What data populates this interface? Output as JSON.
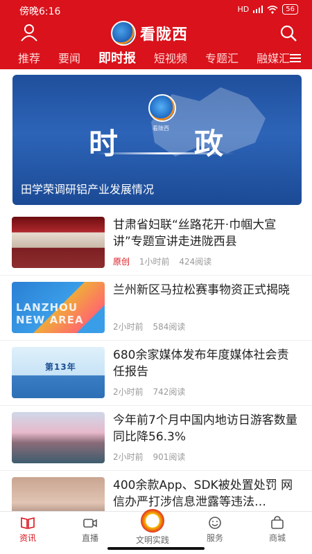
{
  "status_bar": {
    "time": "傍晚6:16",
    "signal": "HD",
    "battery": "56"
  },
  "app": {
    "name": "看陇西"
  },
  "tabs": [
    {
      "label": "推荐"
    },
    {
      "label": "要闻"
    },
    {
      "label": "即时报",
      "active": true
    },
    {
      "label": "短视频"
    },
    {
      "label": "专题汇"
    },
    {
      "label": "融媒汇"
    }
  ],
  "hero": {
    "big_left": "时",
    "big_right": "政",
    "emblem_text": "看陇西",
    "caption": "田学荣调研铝产业发展情况"
  },
  "news": [
    {
      "title": "甘肃省妇联“丝路花开·巾帼大宣讲”专题宣讲走进陇西县",
      "tag": "原创",
      "time": "1小时前",
      "reads": "424阅读",
      "thumb_text": ""
    },
    {
      "title": "兰州新区马拉松赛事物资正式揭晓",
      "tag": "",
      "time": "2小时前",
      "reads": "584阅读",
      "thumb_text": "LANZHOU NEW AREA"
    },
    {
      "title": "680余家媒体发布年度媒体社会责任报告",
      "tag": "",
      "time": "2小时前",
      "reads": "742阅读",
      "thumb_text": "第13年"
    },
    {
      "title": "今年前7个月中国内地访日游客数量同比降56.3%",
      "tag": "",
      "time": "2小时前",
      "reads": "901阅读",
      "thumb_text": ""
    },
    {
      "title": "400余款App、SDK被处置处罚 网信办严打涉信息泄露等违法…",
      "tag": "",
      "time": "",
      "reads": "",
      "thumb_text": ""
    }
  ],
  "bottom_nav": [
    {
      "label": "资讯",
      "icon": "book-icon",
      "active": true
    },
    {
      "label": "直播",
      "icon": "video-camera-icon"
    },
    {
      "label": "文明实践",
      "icon": "civilization-emblem-icon"
    },
    {
      "label": "服务",
      "icon": "smile-icon"
    },
    {
      "label": "商城",
      "icon": "shopping-bag-icon"
    }
  ],
  "colors": {
    "brand_red": "#d9121b",
    "hero_blue": "#2d64b8"
  }
}
